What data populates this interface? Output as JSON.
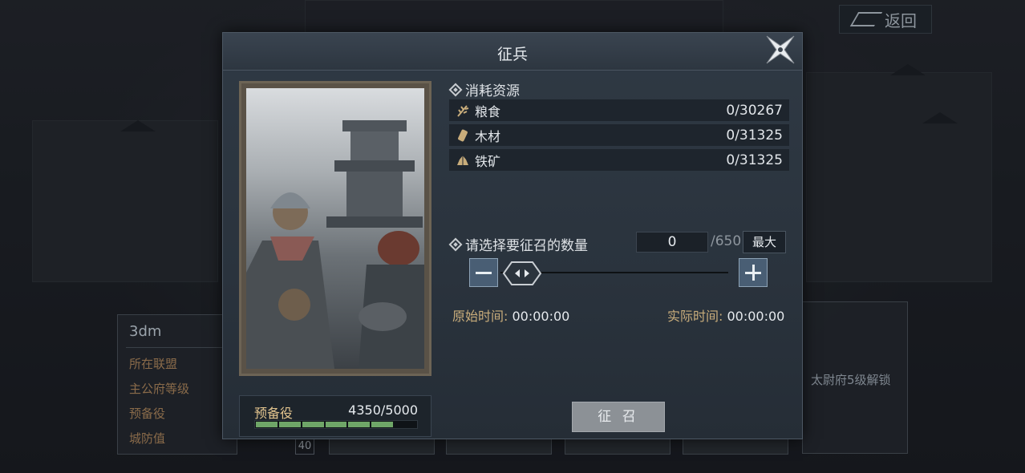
{
  "nav": {
    "back_label": "返回"
  },
  "behind": {
    "player_name": "3dm",
    "rows": [
      "所在联盟",
      "主公府等级",
      "预备役",
      "城防值"
    ],
    "tile_number": "40",
    "unlock_text": "太尉府5级解锁"
  },
  "dialog": {
    "title": "征兵",
    "resources_heading": "消耗资源",
    "resources": [
      {
        "icon": "grain-icon",
        "name": "粮食",
        "value": "0/30267"
      },
      {
        "icon": "wood-icon",
        "name": "木材",
        "value": "0/31325"
      },
      {
        "icon": "iron-ore-icon",
        "name": "铁矿",
        "value": "0/31325"
      }
    ],
    "quantity_heading": "请选择要征召的数量",
    "quantity_value": "0",
    "quantity_max": "/650",
    "max_button": "最大",
    "original_time_label": "原始时间:",
    "original_time": "00:00:00",
    "actual_time_label": "实际时间:",
    "actual_time": "00:00:00",
    "reserve_label": "预备役",
    "reserve_value": "4350/5000",
    "reserve_fraction": 0.87,
    "recruit_button": "征 召"
  },
  "colors": {
    "accent_gold": "#c9ad7b",
    "bar_green": "#6fa668",
    "button_blue": "#495e74"
  }
}
